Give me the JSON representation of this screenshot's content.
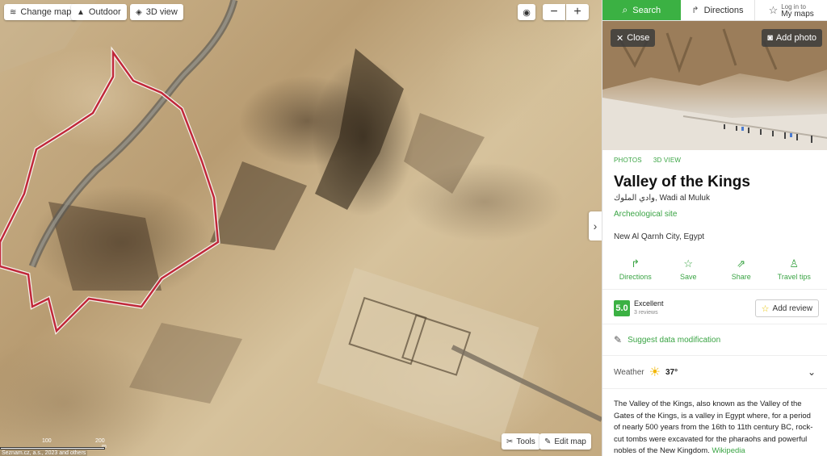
{
  "map": {
    "change_map_label": "Change map",
    "outdoor_label": "Outdoor",
    "view3d_label": "3D view",
    "zoom_out_symbol": "−",
    "zoom_in_symbol": "+",
    "tools_label": "Tools",
    "edit_map_label": "Edit map",
    "scale_marks": [
      "0",
      "100",
      "200"
    ],
    "scale_unit": "m",
    "attribution": "Seznam.cz, a.s., 2023 and others",
    "boundary_color": "#c0283a"
  },
  "tabs": {
    "search_label": "Search",
    "directions_label": "Directions",
    "login_label": "Log in to",
    "mymaps_label": "My maps"
  },
  "photo": {
    "close_label": "Close",
    "add_photo_label": "Add photo"
  },
  "place": {
    "links": [
      "PHOTOS",
      "3D VIEW"
    ],
    "title": "Valley of the Kings",
    "alt_name": "وادي الملوك, Wadi al Muluk",
    "category": "Archeological site",
    "address": "New Al Qarnh City, Egypt"
  },
  "actions": [
    {
      "label": "Directions",
      "icon": "directions-icon"
    },
    {
      "label": "Save",
      "icon": "star-icon"
    },
    {
      "label": "Share",
      "icon": "share-icon"
    },
    {
      "label": "Travel tips",
      "icon": "person-icon"
    }
  ],
  "rating": {
    "score": "5.0",
    "label": "Excellent",
    "count": "3 reviews",
    "add_review_label": "Add review"
  },
  "suggest_label": "Suggest data modification",
  "weather": {
    "label": "Weather",
    "temperature": "37°"
  },
  "description": {
    "text": "The Valley of the Kings, also known as the Valley of the Gates of the Kings, is a valley in Egypt where, for a period of nearly 500 years from the 16th to 11th century BC, rock-cut tombs were excavated for the pharaohs and powerful nobles of the New Kingdom.",
    "source": "Wikipedia"
  },
  "colors": {
    "accent": "#3bb143"
  }
}
